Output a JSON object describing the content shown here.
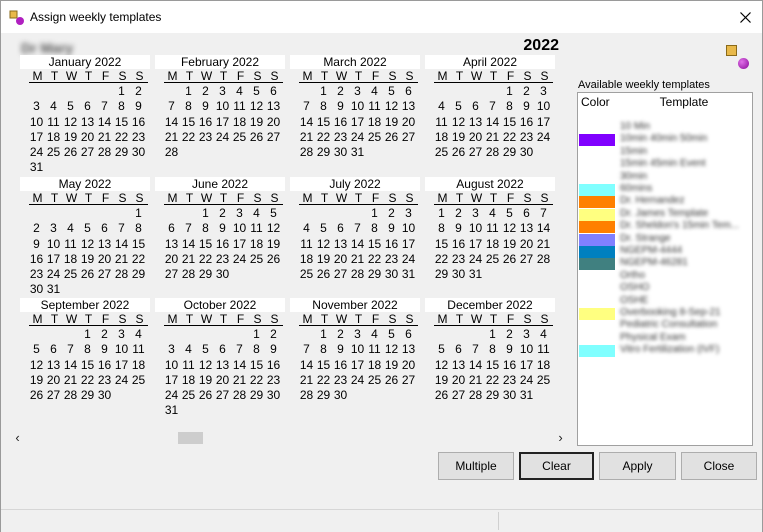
{
  "window": {
    "title": "Assign weekly templates",
    "close_glyph": "✕"
  },
  "header": {
    "person_name": "Dr Mary",
    "year": "2022"
  },
  "calendar": {
    "weekday_headers": [
      "M",
      "T",
      "W",
      "T",
      "F",
      "S",
      "S"
    ],
    "months": [
      {
        "name": "January 2022",
        "first_weekday": 5,
        "days": 31
      },
      {
        "name": "February 2022",
        "first_weekday": 1,
        "days": 28
      },
      {
        "name": "March 2022",
        "first_weekday": 1,
        "days": 31
      },
      {
        "name": "April 2022",
        "first_weekday": 4,
        "days": 30
      },
      {
        "name": "May 2022",
        "first_weekday": 6,
        "days": 31
      },
      {
        "name": "June 2022",
        "first_weekday": 2,
        "days": 30
      },
      {
        "name": "July 2022",
        "first_weekday": 4,
        "days": 31
      },
      {
        "name": "August 2022",
        "first_weekday": 0,
        "days": 31
      },
      {
        "name": "September 2022",
        "first_weekday": 3,
        "days": 30
      },
      {
        "name": "October 2022",
        "first_weekday": 5,
        "days": 31
      },
      {
        "name": "November 2022",
        "first_weekday": 1,
        "days": 30
      },
      {
        "name": "December 2022",
        "first_weekday": 3,
        "days": 31
      }
    ]
  },
  "scrollbar": {
    "left_arrow": "‹",
    "right_arrow": "›"
  },
  "templates_panel": {
    "label": "Available weekly templates",
    "col_color": "Color",
    "col_template": "Template",
    "items": [
      {
        "name": "10 Min",
        "color": ""
      },
      {
        "name": "10min 40min 50min",
        "color": "#8000ff"
      },
      {
        "name": "15min",
        "color": ""
      },
      {
        "name": "15min 45min Event",
        "color": ""
      },
      {
        "name": "30min",
        "color": ""
      },
      {
        "name": "60mins",
        "color": "#80ffff"
      },
      {
        "name": "Dr. Hernandez",
        "color": "#ff8000"
      },
      {
        "name": "Dr. James Template",
        "color": "#ffff80"
      },
      {
        "name": "Dr. Sheldon's 15min Tem...",
        "color": "#ff8000"
      },
      {
        "name": "Dr. Strange",
        "color": "#8080ff"
      },
      {
        "name": "NGEPM-4444",
        "color": "#0080c0"
      },
      {
        "name": "NGEPM-46281",
        "color": "#408080"
      },
      {
        "name": "Ortho",
        "color": ""
      },
      {
        "name": "OSHO",
        "color": ""
      },
      {
        "name": "OSHE",
        "color": ""
      },
      {
        "name": "Overbooking 8-Sep-21",
        "color": "#ffff80"
      },
      {
        "name": "Pediatric Consultation",
        "color": ""
      },
      {
        "name": "Physical Exam",
        "color": ""
      },
      {
        "name": "Vitro Fertilization (IVF)",
        "color": "#80ffff"
      }
    ]
  },
  "buttons": {
    "multiple": "Multiple",
    "clear": "Clear",
    "apply": "Apply",
    "close": "Close"
  }
}
